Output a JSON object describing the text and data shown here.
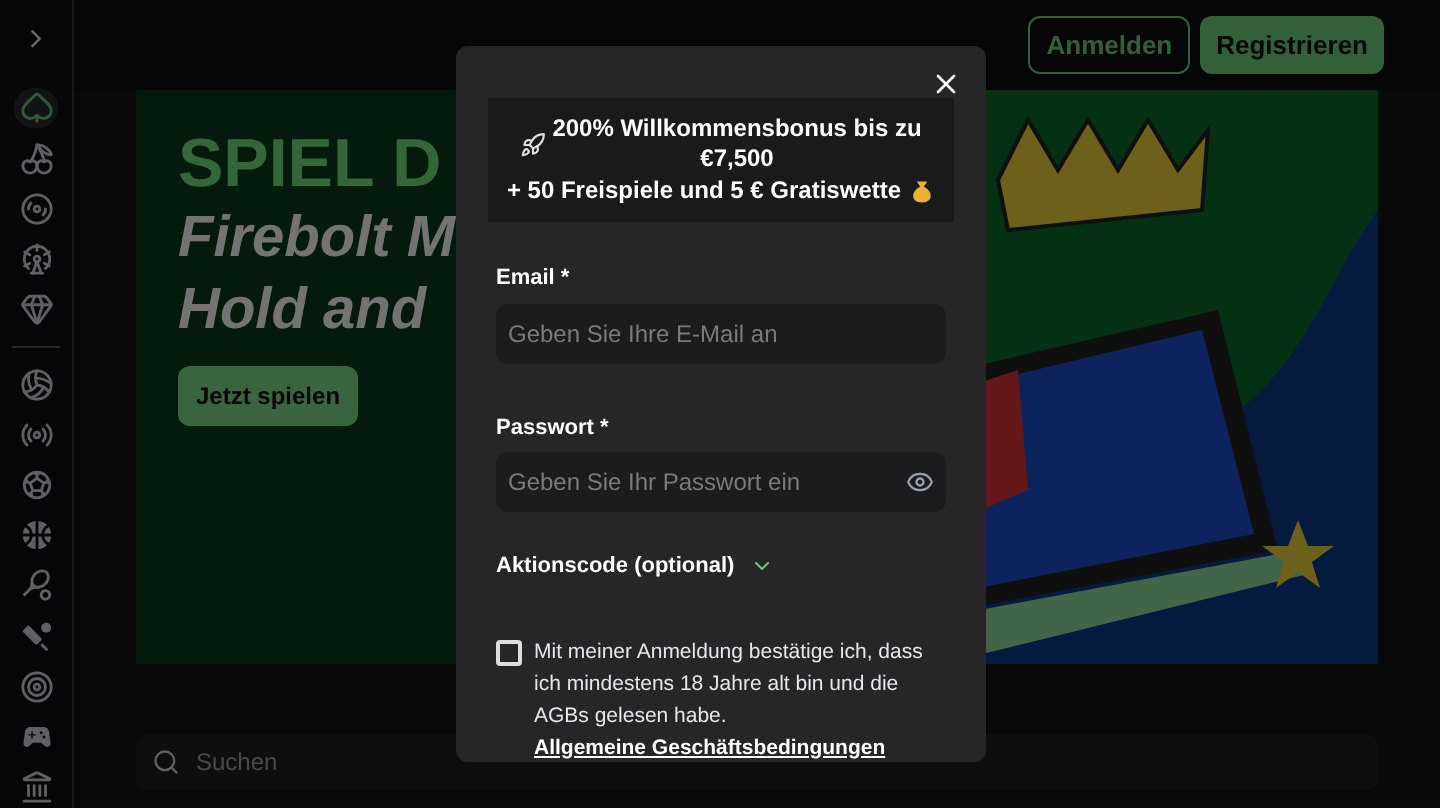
{
  "header": {
    "buttons": [
      {
        "label": "Anmelden",
        "kind": "outline"
      },
      {
        "label": "Registrieren",
        "kind": "filled"
      }
    ]
  },
  "sidebar": {
    "groups": [
      [
        {
          "selected": true
        },
        {
          "selected": false
        },
        {
          "selected": false
        },
        {
          "selected": false
        },
        {
          "selected": false
        }
      ],
      [
        {
          "selected": false
        },
        {
          "selected": false
        },
        {
          "selected": false
        },
        {
          "selected": false
        },
        {
          "selected": false
        },
        {
          "selected": false
        },
        {
          "selected": false
        },
        {
          "selected": false
        },
        {
          "selected": false
        }
      ]
    ]
  },
  "banner": {
    "title": "SPIEL D",
    "subtitle_lines": [
      "Firebolt M",
      "Hold and"
    ],
    "button": "Jetzt spielen"
  },
  "search": {
    "placeholder": "Suchen"
  },
  "modal": {
    "bonus_lines": [
      "200% Willkommensbonus bis zu €7,500",
      "+ 50 Freispiele und 5 € Gratiswette"
    ],
    "fields": [
      {
        "label": "Email *",
        "placeholder": "Geben Sie Ihre E-Mail an",
        "kind": "text"
      },
      {
        "label": "Passwort *",
        "placeholder": "Geben Sie Ihr Passwort ein",
        "kind": "password"
      }
    ],
    "promo": {
      "label": "Aktionscode (optional)",
      "expanded": false
    },
    "consent": {
      "text": "Mit meiner Anmeldung bestätige ich, dass ich mindestens 18 Jahre alt bin und die AGBs gelesen habe.",
      "link": "Allgemeine Geschäftsbedingungen",
      "checked": false
    }
  }
}
